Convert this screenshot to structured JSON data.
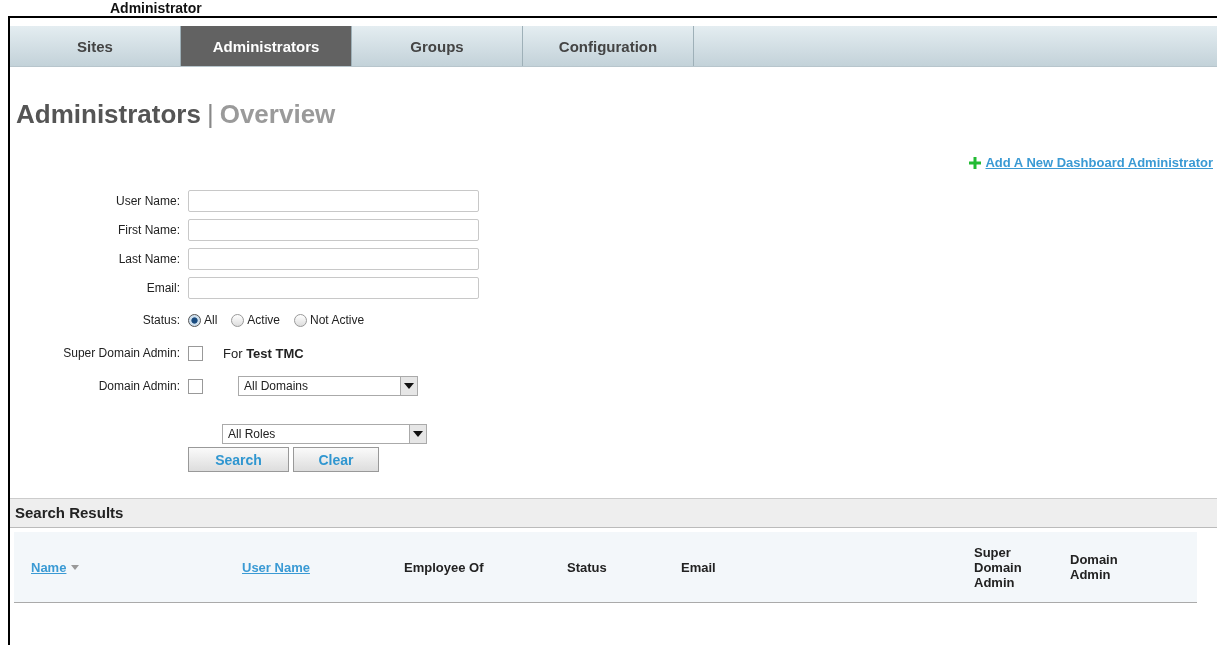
{
  "page_title": "Administrator",
  "tabs": [
    {
      "label": "Sites",
      "selected": false
    },
    {
      "label": "Administrators",
      "selected": true
    },
    {
      "label": "Groups",
      "selected": false
    },
    {
      "label": "Configuration",
      "selected": false
    }
  ],
  "heading": {
    "title": "Administrators",
    "separator": "|",
    "subtitle": "Overview"
  },
  "add_link": {
    "label": "Add A New Dashboard Administrator"
  },
  "form": {
    "fields": [
      {
        "kind": "text",
        "label": "User Name:"
      },
      {
        "kind": "text",
        "label": "First Name:"
      },
      {
        "kind": "text",
        "label": "Last Name:"
      },
      {
        "kind": "text",
        "label": "Email:"
      },
      {
        "kind": "radio",
        "label": "Status:",
        "options": [
          {
            "label": "All",
            "selected": true
          },
          {
            "label": "Active",
            "selected": false
          },
          {
            "label": "Not Active",
            "selected": false
          }
        ]
      },
      {
        "kind": "checkbox",
        "label": "Super Domain Admin:",
        "checked": false,
        "note": "For **Test TMC**"
      },
      {
        "kind": "checkbox_select",
        "label": "Domain Admin:",
        "checked": false,
        "select": "All Domains"
      },
      {
        "kind": "select",
        "select": "All Roles"
      }
    ],
    "buttons": [
      "Search",
      "Clear"
    ]
  },
  "results": {
    "title": "Search Results",
    "columns": [
      {
        "label": "Name",
        "kind": "sorted_link"
      },
      {
        "label": "User Name",
        "kind": "link"
      },
      {
        "label": "Employee Of",
        "kind": "plain"
      },
      {
        "label": "Status",
        "kind": "plain"
      },
      {
        "label": "Email",
        "kind": "plain"
      },
      {
        "label": "Super Domain Admin",
        "kind": "plain"
      },
      {
        "label": "Domain Admin",
        "kind": "plain"
      }
    ]
  }
}
